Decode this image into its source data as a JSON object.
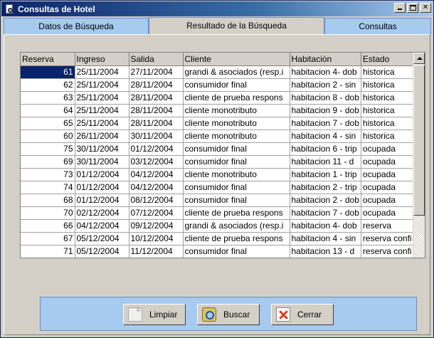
{
  "window": {
    "title": "Consultas de Hotel",
    "controls": {
      "minimize": "_",
      "close": "✕"
    }
  },
  "tabs": [
    {
      "label": "Datos de Búsqueda",
      "active": false
    },
    {
      "label": "Resultado de la Búsqueda",
      "active": true
    },
    {
      "label": "Consultas",
      "active": false
    }
  ],
  "table": {
    "columns": [
      "Reserva",
      "Ingreso",
      "Salida",
      "Cliente",
      "Habitación",
      "Estado"
    ],
    "rows": [
      [
        "61",
        "25/11/2004",
        "27/11/2004",
        "grandi & asociados (resp.i",
        "habitacion 4- dob",
        "historica"
      ],
      [
        "62",
        "25/11/2004",
        "28/11/2004",
        "consumidor final",
        "habitacion 2 - sin",
        "historica"
      ],
      [
        "63",
        "25/11/2004",
        "28/11/2004",
        "cliente de prueba respons",
        "habitacion 8 - dob",
        "historica"
      ],
      [
        "64",
        "25/11/2004",
        "28/11/2004",
        "cliente monotributo",
        "habitacion 9 - dob",
        "historica"
      ],
      [
        "65",
        "25/11/2004",
        "28/11/2004",
        "cliente monotributo",
        "habitacion 7 - dob",
        "historica"
      ],
      [
        "60",
        "26/11/2004",
        "30/11/2004",
        "cliente monotributo",
        "habitacion 4 - sin",
        "historica"
      ],
      [
        "75",
        "30/11/2004",
        "01/12/2004",
        "consumidor final",
        "habitacion 6 - trip",
        "ocupada"
      ],
      [
        "69",
        "30/11/2004",
        "03/12/2004",
        "consumidor final",
        "habitacion 11 - d",
        "ocupada"
      ],
      [
        "73",
        "01/12/2004",
        "04/12/2004",
        "cliente monotributo",
        "habitacion 1 - trip",
        "ocupada"
      ],
      [
        "74",
        "01/12/2004",
        "04/12/2004",
        "consumidor final",
        "habitacion 2 - trip",
        "ocupada"
      ],
      [
        "68",
        "01/12/2004",
        "08/12/2004",
        "consumidor final",
        "habitacion 2 - dob",
        "ocupada"
      ],
      [
        "70",
        "02/12/2004",
        "07/12/2004",
        "cliente de prueba respons",
        "habitacion 7 - dob",
        "ocupada"
      ],
      [
        "66",
        "04/12/2004",
        "09/12/2004",
        "grandi & asociados (resp.i",
        "habitacion 4- dob",
        "reserva"
      ],
      [
        "67",
        "05/12/2004",
        "10/12/2004",
        "cliente de prueba respons",
        "habitacion 4 - sin",
        "reserva confi"
      ],
      [
        "71",
        "05/12/2004",
        "11/12/2004",
        "consumidor final",
        "habitacion 13 - d",
        "reserva confi"
      ]
    ],
    "selected_row": 0
  },
  "buttons": {
    "clear": "Limpiar",
    "search": "Buscar",
    "close": "Cerrar"
  },
  "colors": {
    "titlebar_start": "#0a246a",
    "titlebar_end": "#a6caf0",
    "tab_inactive": "#a6caf0",
    "selection": "#0a246a",
    "button_bar": "#a6caf0"
  },
  "icons": {
    "app": "hotel-search-icon",
    "clear": "blank-page-icon",
    "search": "magnifier-icon",
    "close": "red-x-icon"
  }
}
